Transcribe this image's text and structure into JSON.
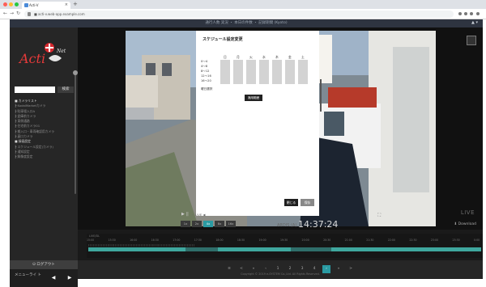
{
  "browser": {
    "tab_title": "Acti-V",
    "url": "■ acti-v.web-app.example.com",
    "new_tab_symbol": "+",
    "back_symbol": "←",
    "forward_symbol": "→",
    "reload_symbol": "↻"
  },
  "app": {
    "top_center": "通行人数 実況 ・ 本日の件数 ・ 記録期間 (Kyoto)",
    "user_menu": "▲ ▾"
  },
  "sidebar": {
    "logo_text": "Acti",
    "logo_suffix": "Net",
    "search_placeholder": "",
    "search_button": "検索",
    "items": [
      {
        "label": "■ カメラリスト",
        "head": true
      },
      {
        "label": "┣ KodaiMarketカメラ",
        "head": false
      },
      {
        "label": "┣ 駐車場入口A",
        "head": false
      },
      {
        "label": "┣ 倉庫前カメラ",
        "head": false
      },
      {
        "label": "┣ 東側通路",
        "head": false
      },
      {
        "label": "┣ 住宅前カメラ01",
        "head": false
      },
      {
        "label": "┣ 搬入口・車両確認用カメラ",
        "head": false
      },
      {
        "label": "┣ 裏口カメラ",
        "head": false
      },
      {
        "label": "■ 録画設定",
        "head": true
      },
      {
        "label": "┣ スケジュール設定(カメラ)",
        "head": false
      },
      {
        "label": "┣ 通知設定",
        "head": false
      },
      {
        "label": "┣ 解像度設定",
        "head": false
      }
    ],
    "logout": "⏻ ログアウト",
    "menu_label": "メニューライ ト",
    "prev": "◀",
    "next": "▶"
  },
  "dialog": {
    "title": "スケジュール設定変更",
    "days": [
      "日",
      "月",
      "火",
      "水",
      "木",
      "金",
      "土"
    ],
    "rows": [
      "0〜4",
      "4〜8",
      "8〜12",
      "12〜16",
      "16〜20"
    ],
    "dow_label": "曜日選択",
    "apply_button": "適用範囲",
    "close_button": "閉じる",
    "save_button": "保存"
  },
  "video": {
    "live_label": "LIVE",
    "scene_colors": {
      "sky": "#9fb3c8",
      "wall": "#e6e6e2",
      "road": "#8d8d86",
      "truck": "#f2f2f2",
      "crane": "#b63a2a"
    }
  },
  "controls": {
    "play_icons": "▶ ||",
    "play_text": "・ LIVE ◀",
    "speeds": [
      "1x",
      "2x",
      "4x",
      "8x",
      "16x"
    ],
    "active_speed": "4x",
    "camera_name": "ARDIS (A)",
    "clock": "14:37:24",
    "grid_icon": "⛶",
    "download": "⬇ Download"
  },
  "timeline": {
    "label_top": "LIVE/DL",
    "times": [
      "15:00",
      "15:30",
      "16:00",
      "16:30",
      "17:00",
      "17:30",
      "18:00",
      "18:30",
      "19:00",
      "19:30",
      "20:00",
      "20:30",
      "21:00",
      "21:30",
      "22:00",
      "22:30",
      "23:00",
      "23:30",
      "0:00"
    ],
    "markers_text": "| | | | | | | | | | | | | | | | | | | | | | | | | | | | | | | | | | | | | | | | | | | | | | | | | | | | | | | | | | | | | | | | | | |"
  },
  "pager": {
    "items": [
      "≡",
      "<",
      "«",
      "‹",
      "1",
      "2",
      "3",
      "4",
      "›",
      "»",
      ">"
    ],
    "active_index": 8
  },
  "footer": "Copyright © 2019 e-SYSTEM Co.,Ltd. All Rights Reserved."
}
